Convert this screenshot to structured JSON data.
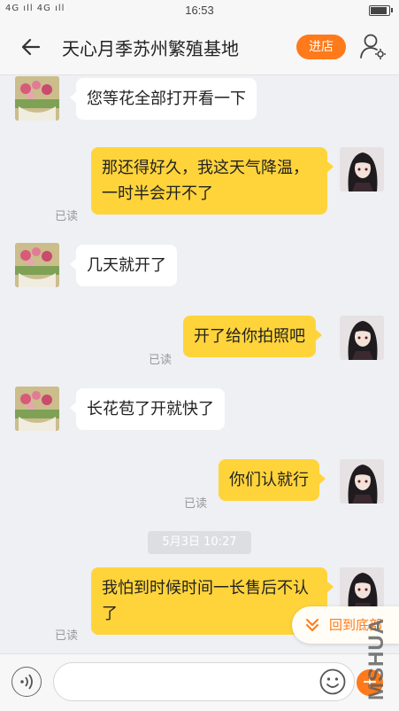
{
  "status_bar": {
    "signal": "4G ıll 4G ıll",
    "time": "16:53",
    "battery_level": 0.8
  },
  "header": {
    "title": "天心月季苏州繁殖基地",
    "shop_button": "进店"
  },
  "messages": [
    {
      "side": "left",
      "text": "您等花全部打开看一下"
    },
    {
      "side": "right",
      "text": "那还得好久，我这天气降温，一时半会开不了",
      "status": "已读"
    },
    {
      "side": "left",
      "text": "几天就开了"
    },
    {
      "side": "right",
      "text": "开了给你拍照吧",
      "status": "已读"
    },
    {
      "side": "left",
      "text": "长花苞了开就快了"
    },
    {
      "side": "right",
      "text": "你们认就行",
      "status": "已读"
    },
    {
      "side": "right",
      "text": "我怕到时候时间一长售后不认了",
      "status": "已读"
    }
  ],
  "timestamp": "5月3日 10:27",
  "scroll_to_bottom": "回到底部",
  "input": {
    "value": ""
  },
  "watermark": "MSHUA",
  "colors": {
    "accent": "#ff7a1a",
    "bubble_right": "#ffd43a",
    "bubble_left": "#ffffff",
    "background": "#eef0f3"
  },
  "icons": {
    "back": "arrow-left-icon",
    "profile": "user-gear-icon",
    "voice": "voice-icon",
    "emoji": "smiley-icon",
    "more": "plus-icon",
    "scroll": "double-chevron-down-icon"
  }
}
